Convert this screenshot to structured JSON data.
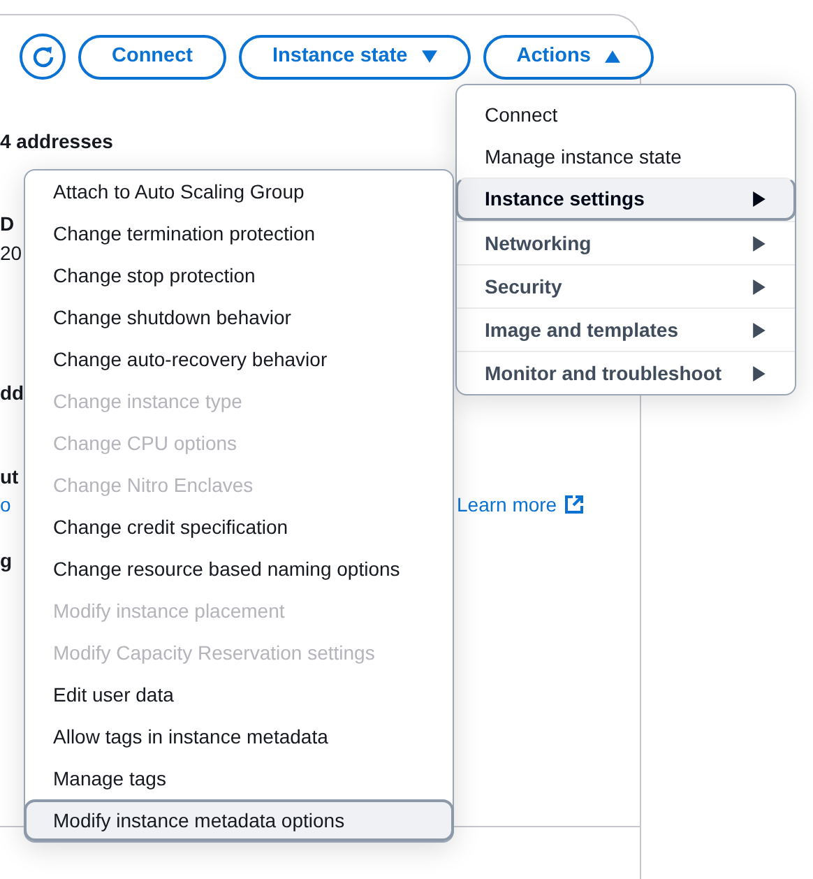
{
  "toolbar": {
    "refresh": {
      "kind": "icon"
    },
    "buttons": [
      {
        "label": "Connect",
        "kind": "button"
      },
      {
        "label": "Instance state",
        "kind": "dropdown",
        "expanded": false
      },
      {
        "label": "Actions",
        "kind": "dropdown",
        "expanded": true
      }
    ]
  },
  "background": [
    {
      "text": "4 addresses",
      "kind": "label"
    },
    {
      "text": "D",
      "kind": "label"
    },
    {
      "text": "20",
      "kind": "value"
    },
    {
      "text": "dd",
      "kind": "label"
    },
    {
      "text": "ut",
      "kind": "label"
    },
    {
      "text": "o",
      "kind": "link"
    },
    {
      "text": "g",
      "kind": "label"
    },
    {
      "text": "Learn more",
      "kind": "external-link"
    }
  ],
  "actions_menu": [
    {
      "label": "Connect",
      "kind": "item",
      "selected": false
    },
    {
      "label": "Manage instance state",
      "kind": "item",
      "selected": false
    },
    {
      "label": "Instance settings",
      "kind": "submenu",
      "selected": true
    },
    {
      "label": "Networking",
      "kind": "submenu",
      "selected": false
    },
    {
      "label": "Security",
      "kind": "submenu",
      "selected": false
    },
    {
      "label": "Image and templates",
      "kind": "submenu",
      "selected": false
    },
    {
      "label": "Monitor and troubleshoot",
      "kind": "submenu",
      "selected": false
    }
  ],
  "instance_settings_menu": [
    {
      "label": "Attach to Auto Scaling Group",
      "disabled": false,
      "selected": false
    },
    {
      "label": "Change termination protection",
      "disabled": false,
      "selected": false
    },
    {
      "label": "Change stop protection",
      "disabled": false,
      "selected": false
    },
    {
      "label": "Change shutdown behavior",
      "disabled": false,
      "selected": false
    },
    {
      "label": "Change auto-recovery behavior",
      "disabled": false,
      "selected": false
    },
    {
      "label": "Change instance type",
      "disabled": true,
      "selected": false
    },
    {
      "label": "Change CPU options",
      "disabled": true,
      "selected": false
    },
    {
      "label": "Change Nitro Enclaves",
      "disabled": true,
      "selected": false
    },
    {
      "label": "Change credit specification",
      "disabled": false,
      "selected": false
    },
    {
      "label": "Change resource based naming options",
      "disabled": false,
      "selected": false
    },
    {
      "label": "Modify instance placement",
      "disabled": true,
      "selected": false
    },
    {
      "label": "Modify Capacity Reservation settings",
      "disabled": true,
      "selected": false
    },
    {
      "label": "Edit user data",
      "disabled": false,
      "selected": false
    },
    {
      "label": "Allow tags in instance metadata",
      "disabled": false,
      "selected": false
    },
    {
      "label": "Manage tags",
      "disabled": false,
      "selected": false
    },
    {
      "label": "Modify instance metadata options",
      "disabled": false,
      "selected": true
    }
  ]
}
